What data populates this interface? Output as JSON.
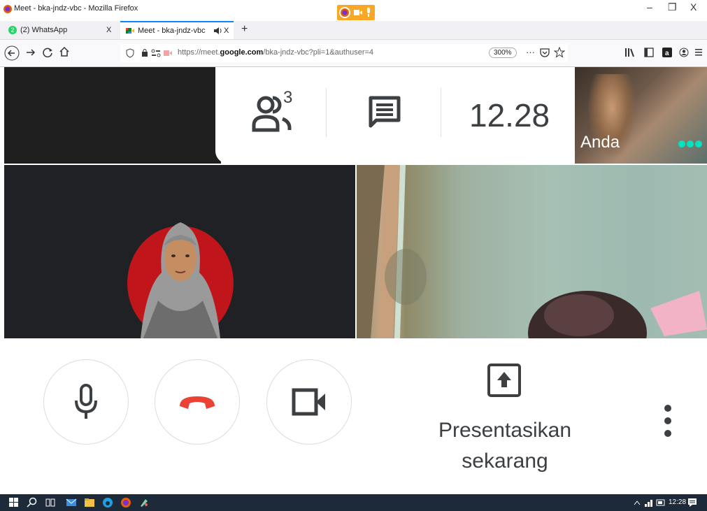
{
  "browser": {
    "window_title": "Meet - bka-jndz-vbc - Mozilla Firefox",
    "tabs": [
      {
        "label": "(2) WhatsApp",
        "badge": "2",
        "close": "X"
      },
      {
        "label": "Meet - bka-jndz-vbc",
        "close": "X"
      }
    ],
    "new_tab": "+",
    "url_prefix": "https://meet.",
    "url_domain": "google.com",
    "url_path": "/bka-jndz-vbc?pli=1&authuser=4",
    "zoom": "300%",
    "more": "···",
    "window_controls": {
      "minimize": "–",
      "restore": "❐",
      "close": "X"
    }
  },
  "meet": {
    "participants_count": "3",
    "clock": "12.28",
    "self_label": "Anda",
    "present_label_line1": "Presentasikan",
    "present_label_line2": "sekarang"
  },
  "taskbar": {
    "time": "12:28"
  },
  "colors": {
    "accent": "#0a84ff",
    "hangup": "#ea4335",
    "taskbar": "#1c2a3a",
    "meet_dark": "#202124",
    "self_dots": "#00e5c0"
  }
}
